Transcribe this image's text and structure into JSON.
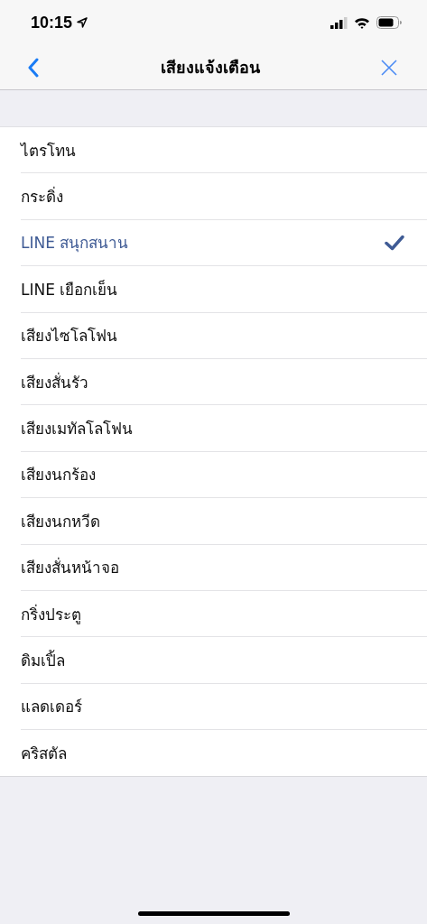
{
  "status_bar": {
    "time": "10:15"
  },
  "nav": {
    "title": "เสียงแจ้งเตือน"
  },
  "sounds": [
    {
      "label": "ไตรโทน",
      "selected": false
    },
    {
      "label": "กระดิ่ง",
      "selected": false
    },
    {
      "label": "LINE สนุกสนาน",
      "selected": true
    },
    {
      "label": "LINE เยือกเย็น",
      "selected": false
    },
    {
      "label": "เสียงไซโลโฟน",
      "selected": false
    },
    {
      "label": "เสียงสั่นรัว",
      "selected": false
    },
    {
      "label": "เสียงเมทัลโลโฟน",
      "selected": false
    },
    {
      "label": "เสียงนกร้อง",
      "selected": false
    },
    {
      "label": "เสียงนกหวีด",
      "selected": false
    },
    {
      "label": "เสียงสั่นหน้าจอ",
      "selected": false
    },
    {
      "label": "กริ่งประตู",
      "selected": false
    },
    {
      "label": "ดิมเปิ้ล",
      "selected": false
    },
    {
      "label": "แลดเดอร์",
      "selected": false
    },
    {
      "label": "คริสตัล",
      "selected": false
    }
  ]
}
